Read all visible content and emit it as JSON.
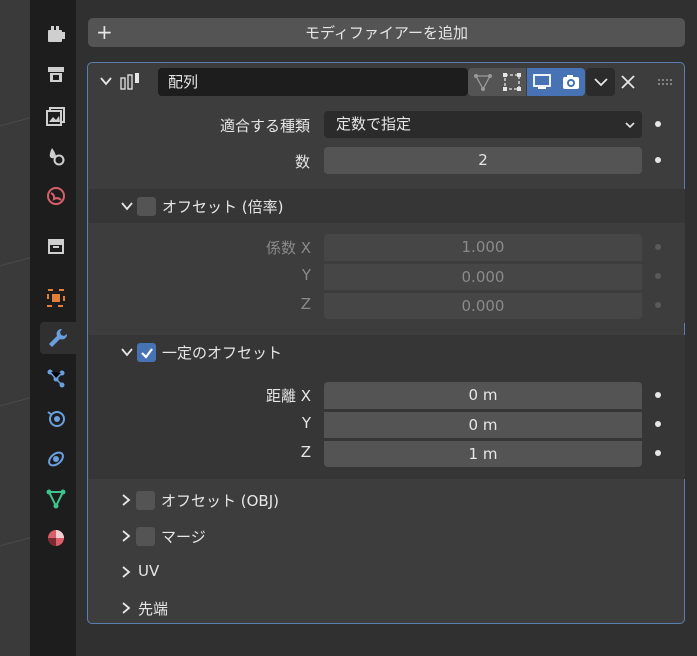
{
  "add_modifier_label": "モディファイアーを追加",
  "modifier": {
    "name": "配列",
    "fit_type_label": "適合する種類",
    "fit_type_value": "定数で指定",
    "count_label": "数",
    "count_value": "2"
  },
  "relative_offset": {
    "title": "オフセット (倍率)",
    "checked": false,
    "rows": [
      {
        "label": "係数 X",
        "value": "1.000"
      },
      {
        "label": "Y",
        "value": "0.000"
      },
      {
        "label": "Z",
        "value": "0.000"
      }
    ]
  },
  "constant_offset": {
    "title": "一定のオフセット",
    "checked": true,
    "rows": [
      {
        "label": "距離 X",
        "value": "0 m"
      },
      {
        "label": "Y",
        "value": "0 m"
      },
      {
        "label": "Z",
        "value": "1 m"
      }
    ]
  },
  "collapsed_sections": [
    {
      "title": "オフセット (OBJ)",
      "has_checkbox": true
    },
    {
      "title": "マージ",
      "has_checkbox": true
    },
    {
      "title": "UV",
      "has_checkbox": false
    },
    {
      "title": "先端",
      "has_checkbox": false
    }
  ],
  "colors": {
    "accent": "#4772b3",
    "panel_border": "#5a7fb0",
    "wrench_active": "#6aa0e0"
  },
  "tabs": [
    {
      "name": "tool-icon",
      "active": false
    },
    {
      "name": "render-icon",
      "active": false
    },
    {
      "name": "output-icon",
      "active": false
    },
    {
      "name": "view-layer-icon",
      "active": false
    },
    {
      "name": "scene-icon",
      "active": false
    },
    {
      "name": "world-icon",
      "active": false
    },
    {
      "name": "collection-icon",
      "active": false
    },
    {
      "name": "object-icon",
      "active": false
    },
    {
      "name": "modifier-wrench-icon",
      "active": true
    },
    {
      "name": "particles-icon",
      "active": false
    },
    {
      "name": "physics-icon",
      "active": false
    },
    {
      "name": "constraints-icon",
      "active": false
    },
    {
      "name": "data-icon",
      "active": false
    },
    {
      "name": "material-icon",
      "active": false
    }
  ]
}
